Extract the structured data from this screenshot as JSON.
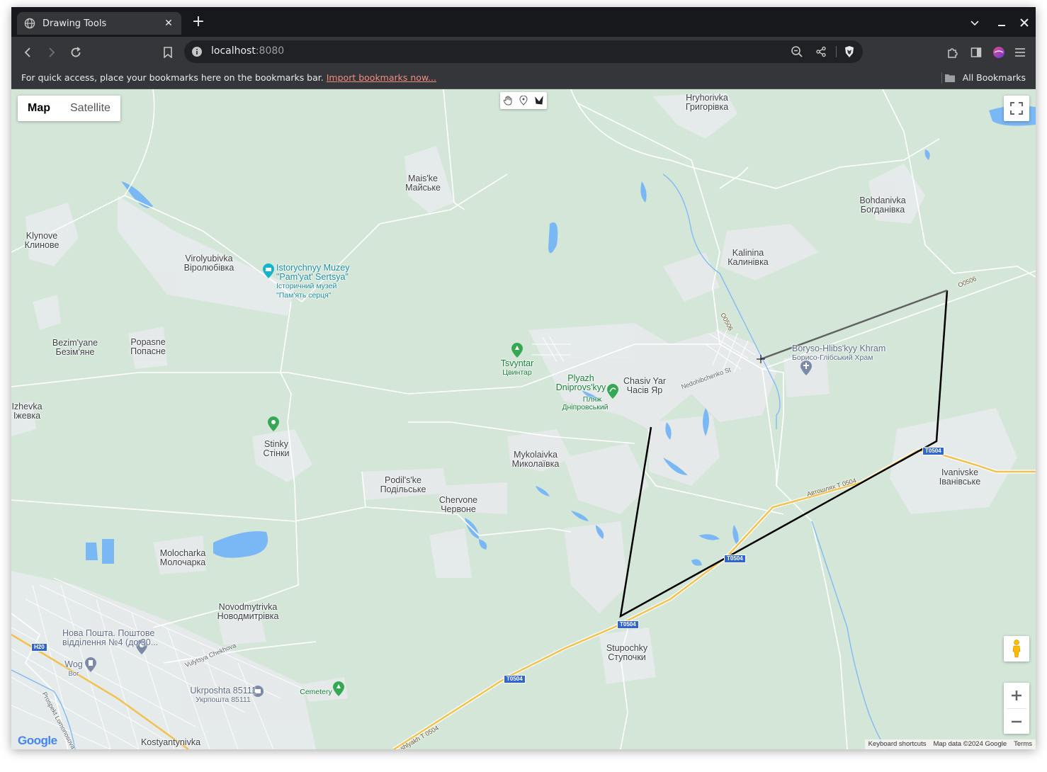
{
  "browser": {
    "tab_title": "Drawing Tools",
    "url_host": "localhost",
    "url_port": ":8080",
    "bookmarks_message": "For quick access, place your bookmarks here on the bookmarks bar.",
    "import_link": "Import bookmarks now...",
    "all_bookmarks": "All Bookmarks"
  },
  "map": {
    "maptype": {
      "map": "Map",
      "satellite": "Satellite",
      "selected": "Map"
    },
    "drawing_tools": [
      "hand-icon",
      "marker-icon",
      "polyline-icon"
    ],
    "attribution": {
      "shortcuts": "Keyboard shortcuts",
      "data": "Map data ©2024 Google",
      "terms": "Terms"
    },
    "logo": "Google",
    "colors": {
      "land": "#d4e6d8",
      "urban": "#e8eaed",
      "water": "#7ab8f5",
      "highway": "#f2c14e",
      "polygon_stroke": "#000000"
    },
    "places": [
      {
        "id": "hryhorivka",
        "latin": "Hryhorivka",
        "cyr": "Григорівка"
      },
      {
        "id": "maiske",
        "latin": "Mais'ke",
        "cyr": "Майське"
      },
      {
        "id": "bohdanivka",
        "latin": "Bohdanivka",
        "cyr": "Богданівка"
      },
      {
        "id": "klynove",
        "latin": "Klynove",
        "cyr": "Клинове"
      },
      {
        "id": "virolyubivka",
        "latin": "Virolyubivka",
        "cyr": "Віролюбівка"
      },
      {
        "id": "kalinina",
        "latin": "Kalinina",
        "cyr": "Калинівка"
      },
      {
        "id": "bezimyane",
        "latin": "Bezim'yane",
        "cyr": "Безім'яне"
      },
      {
        "id": "popasne",
        "latin": "Popasne",
        "cyr": "Попасне"
      },
      {
        "id": "chasivyar",
        "latin": "Chasiv Yar",
        "cyr": "Часів Яр"
      },
      {
        "id": "izhevka",
        "latin": "Izhevka",
        "cyr": "Іжевка"
      },
      {
        "id": "stinky",
        "latin": "Stinky",
        "cyr": "Стінки"
      },
      {
        "id": "mykolaivka",
        "latin": "Mykolaivka",
        "cyr": "Миколаївка"
      },
      {
        "id": "ivanivske",
        "latin": "Ivanivske",
        "cyr": "Іванівське"
      },
      {
        "id": "podilske",
        "latin": "Podil's'ke",
        "cyr": "Подільське"
      },
      {
        "id": "chervone",
        "latin": "Chervone",
        "cyr": "Червоне"
      },
      {
        "id": "molocharka",
        "latin": "Molocharka",
        "cyr": "Молочарка"
      },
      {
        "id": "novodmytrivka",
        "latin": "Novodmytrivka",
        "cyr": "Новодмитрівка"
      },
      {
        "id": "stupochky",
        "latin": "Stupochky",
        "cyr": "Ступочки"
      },
      {
        "id": "kostyantynivka",
        "latin": "Kostyantynivka",
        "cyr": ""
      }
    ],
    "pois": {
      "museum": {
        "latin": "Istorychnyy Muzey",
        "latin2": "\"Pam'yat' Sertsya\"",
        "cyr": "Історичний музей",
        "cyr2": "\"Пам'ять серця\""
      },
      "tsvyntar": {
        "latin": "Tsvyntar",
        "cyr": "Цвинтар"
      },
      "plyazh": {
        "latin": "Plyazh",
        "latin2": "Dniprovs'kyy",
        "cyr": "Пляж",
        "cyr2": "Дніпровський"
      },
      "khram": {
        "latin": "Boryso-Hlibs'kyy Khram",
        "cyr": "Борисо-Глібський Храм"
      },
      "novaposhta": {
        "line1": "Нова Пошта. Поштове",
        "line2": "відділення №4 (до 30..."
      },
      "wog": {
        "latin": "Wog",
        "cyr": "Вог"
      },
      "ukrposhta": {
        "latin": "Ukrposhta 85111",
        "cyr": "Укрпошта 85111"
      },
      "cemetery": {
        "latin": "Cemetery"
      }
    },
    "roads": {
      "o0506": "O0506",
      "o0506b": "O0506",
      "nedohibchenko": "Nedohibchenko St",
      "avtoshliakh": "Автошлях Т 0504",
      "t0504a": "T0504",
      "t0504b": "T0504",
      "t0504c": "T0504",
      "t0504d": "T0504",
      "h20": "H20",
      "chekhova": "Vulytsya Chekhova",
      "lomonosova": "Prospekt Lomonosova",
      "shlyakh": "shlyakh T 0504"
    }
  }
}
